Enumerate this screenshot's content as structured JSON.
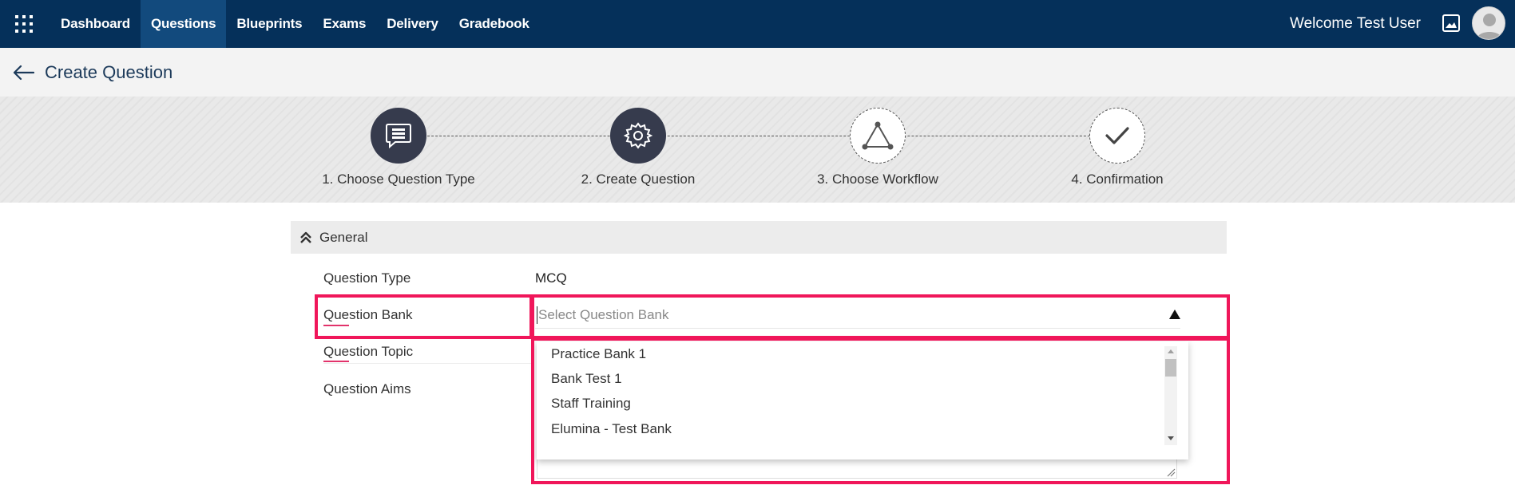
{
  "nav": {
    "items": [
      {
        "label": "Dashboard",
        "active": false
      },
      {
        "label": "Questions",
        "active": true
      },
      {
        "label": "Blueprints",
        "active": false
      },
      {
        "label": "Exams",
        "active": false
      },
      {
        "label": "Delivery",
        "active": false
      },
      {
        "label": "Gradebook",
        "active": false
      }
    ],
    "welcome": "Welcome Test User",
    "icons": [
      "apps-grid-icon",
      "image-icon",
      "avatar"
    ]
  },
  "header": {
    "title": "Create Question"
  },
  "steps": [
    {
      "label": "1. Choose Question Type",
      "icon": "comment-icon",
      "state": "done"
    },
    {
      "label": "2. Create Question",
      "icon": "gear-icon",
      "state": "done"
    },
    {
      "label": "3. Choose Workflow",
      "icon": "workflow-triangle-icon",
      "state": "todo"
    },
    {
      "label": "4. Confirmation",
      "icon": "check-icon",
      "state": "todo"
    }
  ],
  "general": {
    "title": "General",
    "question_type_label": "Question Type",
    "question_type_value": "MCQ",
    "question_bank_label": "Question Bank",
    "question_bank_placeholder": "Select Question Bank",
    "question_topic_label": "Question Topic",
    "question_aims_label": "Question Aims"
  },
  "dropdown": {
    "options": [
      "Practice Bank 1",
      "Bank Test 1",
      "Staff Training",
      "Elumina - Test Bank"
    ]
  },
  "colors": {
    "nav_bg": "#05305a",
    "nav_active": "#124a7d",
    "step_done": "#363b4d",
    "highlight": "#f0165a",
    "required_underline": "#e2336b"
  }
}
